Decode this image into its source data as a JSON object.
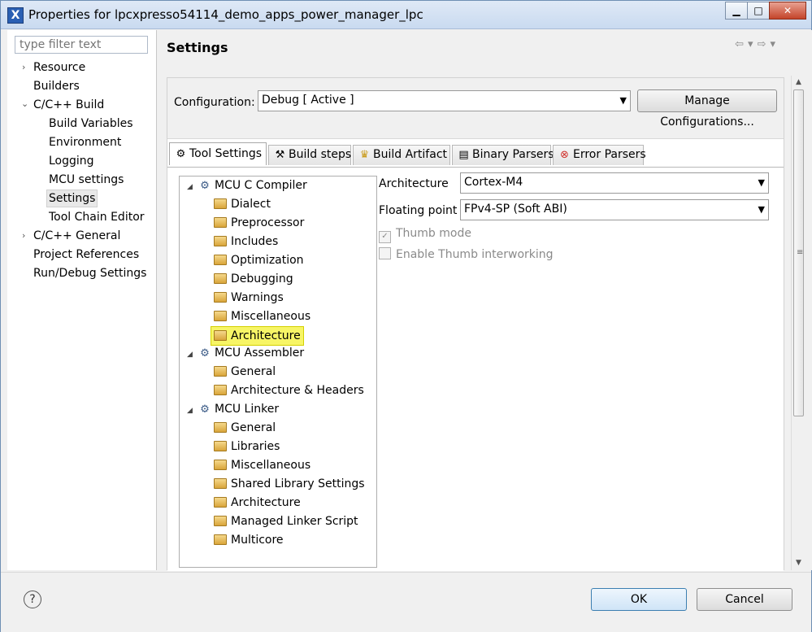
{
  "window": {
    "title": "Properties for lpcxpresso54114_demo_apps_power_manager_lpc"
  },
  "filter": {
    "placeholder": "type filter text"
  },
  "nav": {
    "items": [
      {
        "label": "Resource"
      },
      {
        "label": "Builders"
      },
      {
        "label": "C/C++ Build"
      },
      {
        "label": "Build Variables"
      },
      {
        "label": "Environment"
      },
      {
        "label": "Logging"
      },
      {
        "label": "MCU settings"
      },
      {
        "label": "Settings",
        "selected": true
      },
      {
        "label": "Tool Chain Editor"
      },
      {
        "label": "C/C++ General"
      },
      {
        "label": "Project References"
      },
      {
        "label": "Run/Debug Settings"
      }
    ]
  },
  "page": {
    "title": "Settings"
  },
  "config": {
    "label": "Configuration:",
    "value": "Debug  [ Active ]",
    "manage_label": "Manage Configurations..."
  },
  "tabs": [
    {
      "label": "Tool Settings",
      "icon": "tool-settings-icon",
      "active": true
    },
    {
      "label": "Build steps",
      "icon": "build-steps-icon"
    },
    {
      "label": "Build Artifact",
      "icon": "build-artifact-icon"
    },
    {
      "label": "Binary Parsers",
      "icon": "binary-parsers-icon"
    },
    {
      "label": "Error Parsers",
      "icon": "error-parsers-icon"
    }
  ],
  "tree": {
    "groups": [
      {
        "label": "MCU C Compiler",
        "children": [
          "Dialect",
          "Preprocessor",
          "Includes",
          "Optimization",
          "Debugging",
          "Warnings",
          "Miscellaneous",
          "Architecture"
        ]
      },
      {
        "label": "MCU Assembler",
        "children": [
          "General",
          "Architecture & Headers"
        ]
      },
      {
        "label": "MCU Linker",
        "children": [
          "General",
          "Libraries",
          "Miscellaneous",
          "Shared Library Settings",
          "Architecture",
          "Managed Linker Script",
          "Multicore"
        ]
      }
    ],
    "highlighted": "Architecture"
  },
  "options": {
    "architecture": {
      "label": "Architecture",
      "value": "Cortex-M4"
    },
    "floating_point": {
      "label": "Floating point",
      "value": "FPv4-SP (Soft ABI)"
    },
    "thumb_mode": {
      "label": "Thumb mode",
      "checked": true,
      "enabled": false
    },
    "thumb_interworking": {
      "label": "Enable Thumb interworking",
      "checked": false,
      "enabled": false
    }
  },
  "buttons": {
    "ok": "OK",
    "cancel": "Cancel"
  },
  "colors": {
    "highlight": "#f7f566",
    "title_bar": "#c9daf0"
  }
}
